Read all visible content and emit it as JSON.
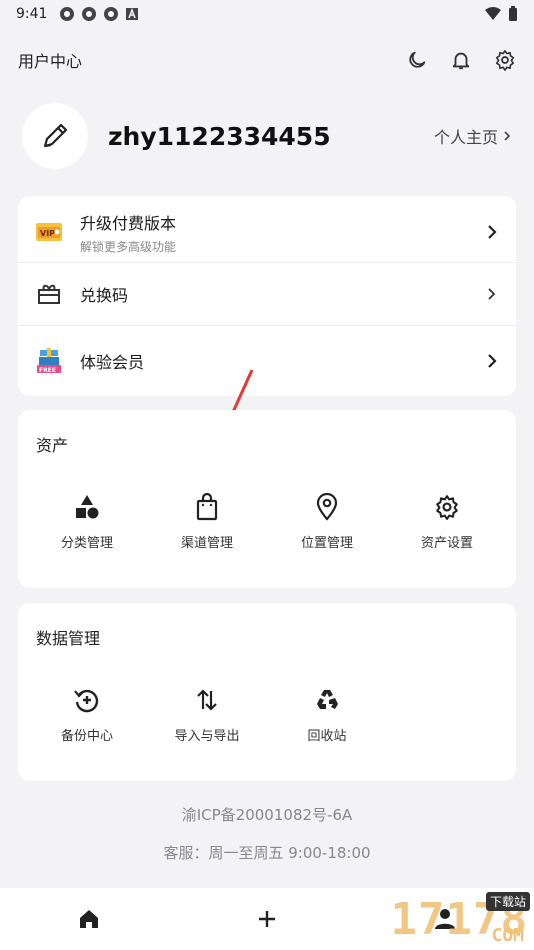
{
  "status_bar": {
    "time": "9:41"
  },
  "header": {
    "title": "用户中心"
  },
  "profile": {
    "username": "zhy1122334455",
    "homepage_link": "个人主页"
  },
  "menu": [
    {
      "label": "升级付费版本",
      "sub": "解锁更多高级功能",
      "icon": "vip-ticket-icon"
    },
    {
      "label": "兑换码",
      "icon": "gift-box-icon"
    },
    {
      "label": "体验会员",
      "icon": "free-gift-icon"
    }
  ],
  "assets": {
    "title": "资产",
    "items": [
      {
        "label": "分类管理",
        "icon": "shapes-icon"
      },
      {
        "label": "渠道管理",
        "icon": "shopping-bag-icon"
      },
      {
        "label": "位置管理",
        "icon": "location-pin-icon"
      },
      {
        "label": "资产设置",
        "icon": "gear-icon"
      }
    ]
  },
  "data_mgmt": {
    "title": "数据管理",
    "items": [
      {
        "label": "备份中心",
        "icon": "backup-icon"
      },
      {
        "label": "导入与导出",
        "icon": "import-export-icon"
      },
      {
        "label": "回收站",
        "icon": "recycle-icon"
      }
    ]
  },
  "footer": {
    "icp": "渝ICP备20001082号-6A",
    "service": "客服：周一至周五 9:00-18:00"
  },
  "watermark": {
    "number": "17178",
    "badge": "下载站",
    "domain": "COM"
  },
  "colors": {
    "background": "#f3f3f5",
    "card": "#ffffff",
    "accent_red": "#e53935"
  }
}
